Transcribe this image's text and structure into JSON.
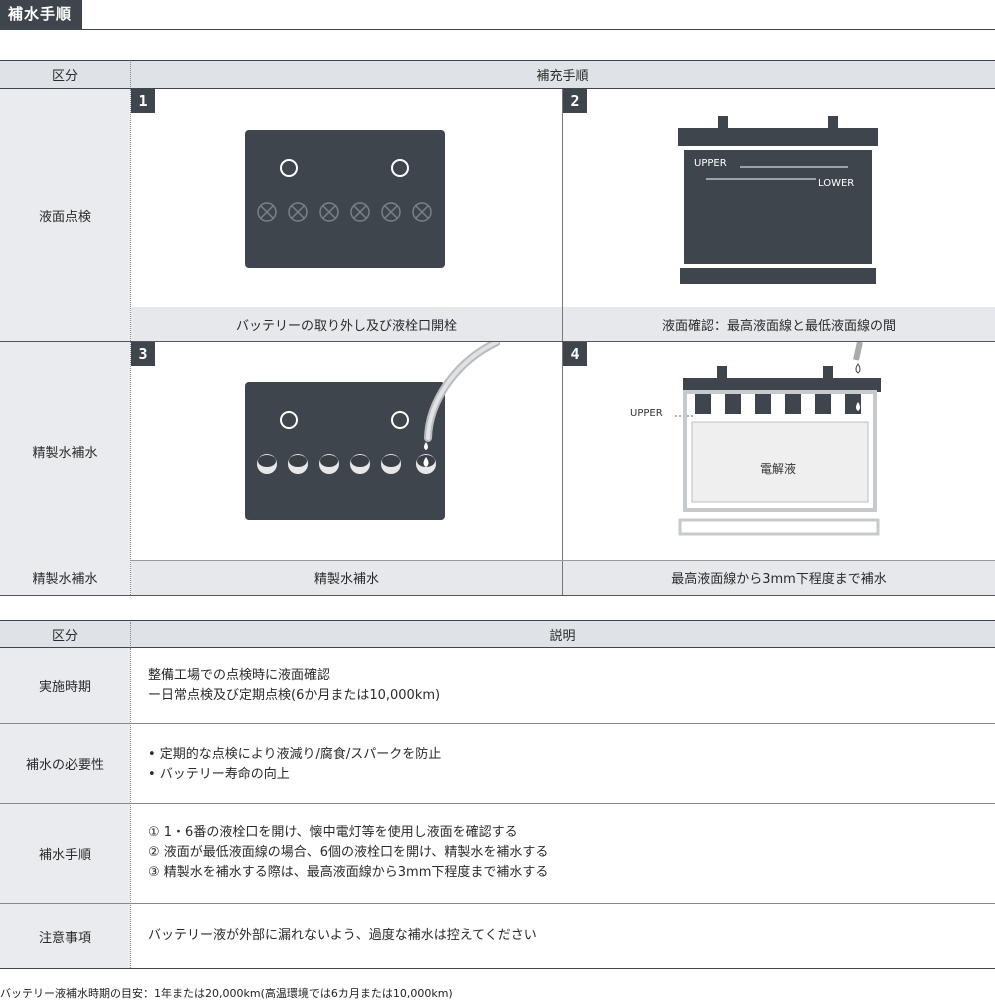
{
  "section_title": "補水手順",
  "table1": {
    "header": {
      "col1": "区分",
      "col2": "補充手順"
    },
    "rows": [
      {
        "label": "液面点検"
      },
      {
        "label": "精製水補水"
      },
      {
        "label": "精製水補水"
      }
    ],
    "steps": [
      {
        "number": "1",
        "caption": "バッテリーの取り外し及び液栓口開栓"
      },
      {
        "number": "2",
        "caption": "液面確認：最高液面線と最低液面線の間",
        "upper": "UPPER",
        "lower": "LOWER"
      },
      {
        "number": "3",
        "caption": "精製水補水"
      },
      {
        "number": "4",
        "caption": "最高液面線から3mm下程度まで補水",
        "upper": "UPPER",
        "electrolyte": "電解液"
      }
    ]
  },
  "table2": {
    "header": {
      "col1": "区分",
      "col2": "説明"
    },
    "rows": [
      {
        "label": "実施時期",
        "lines": [
          "整備工場での点検時に液面確認",
          "ー日常点検及び定期点検(6か月または10,000km)"
        ]
      },
      {
        "label": "補水の必要性",
        "lines": [
          "• 定期的な点検により液減り/腐食/スパークを防止",
          "• バッテリー寿命の向上"
        ]
      },
      {
        "label": "補水手順",
        "lines": [
          "① 1・6番の液栓口を開け、懐中電灯等を使用し液面を確認する",
          "② 液面が最低液面線の場合、6個の液栓口を開け、精製水を補水する",
          "③ 精製水を補水する際は、最高液面線から3mm下程度まで補水する"
        ]
      },
      {
        "label": "注意事項",
        "lines": [
          "バッテリー液が外部に漏れないよう、過度な補水は控えてください"
        ]
      }
    ]
  },
  "footnote": "バッテリー液補水時期の目安：1年または20,000km(高温環境では6カ月または10,000km)",
  "colors": {
    "dark": "#3f454c",
    "header_bg": "#dfe2e6",
    "side_bg": "#e9ebee"
  }
}
